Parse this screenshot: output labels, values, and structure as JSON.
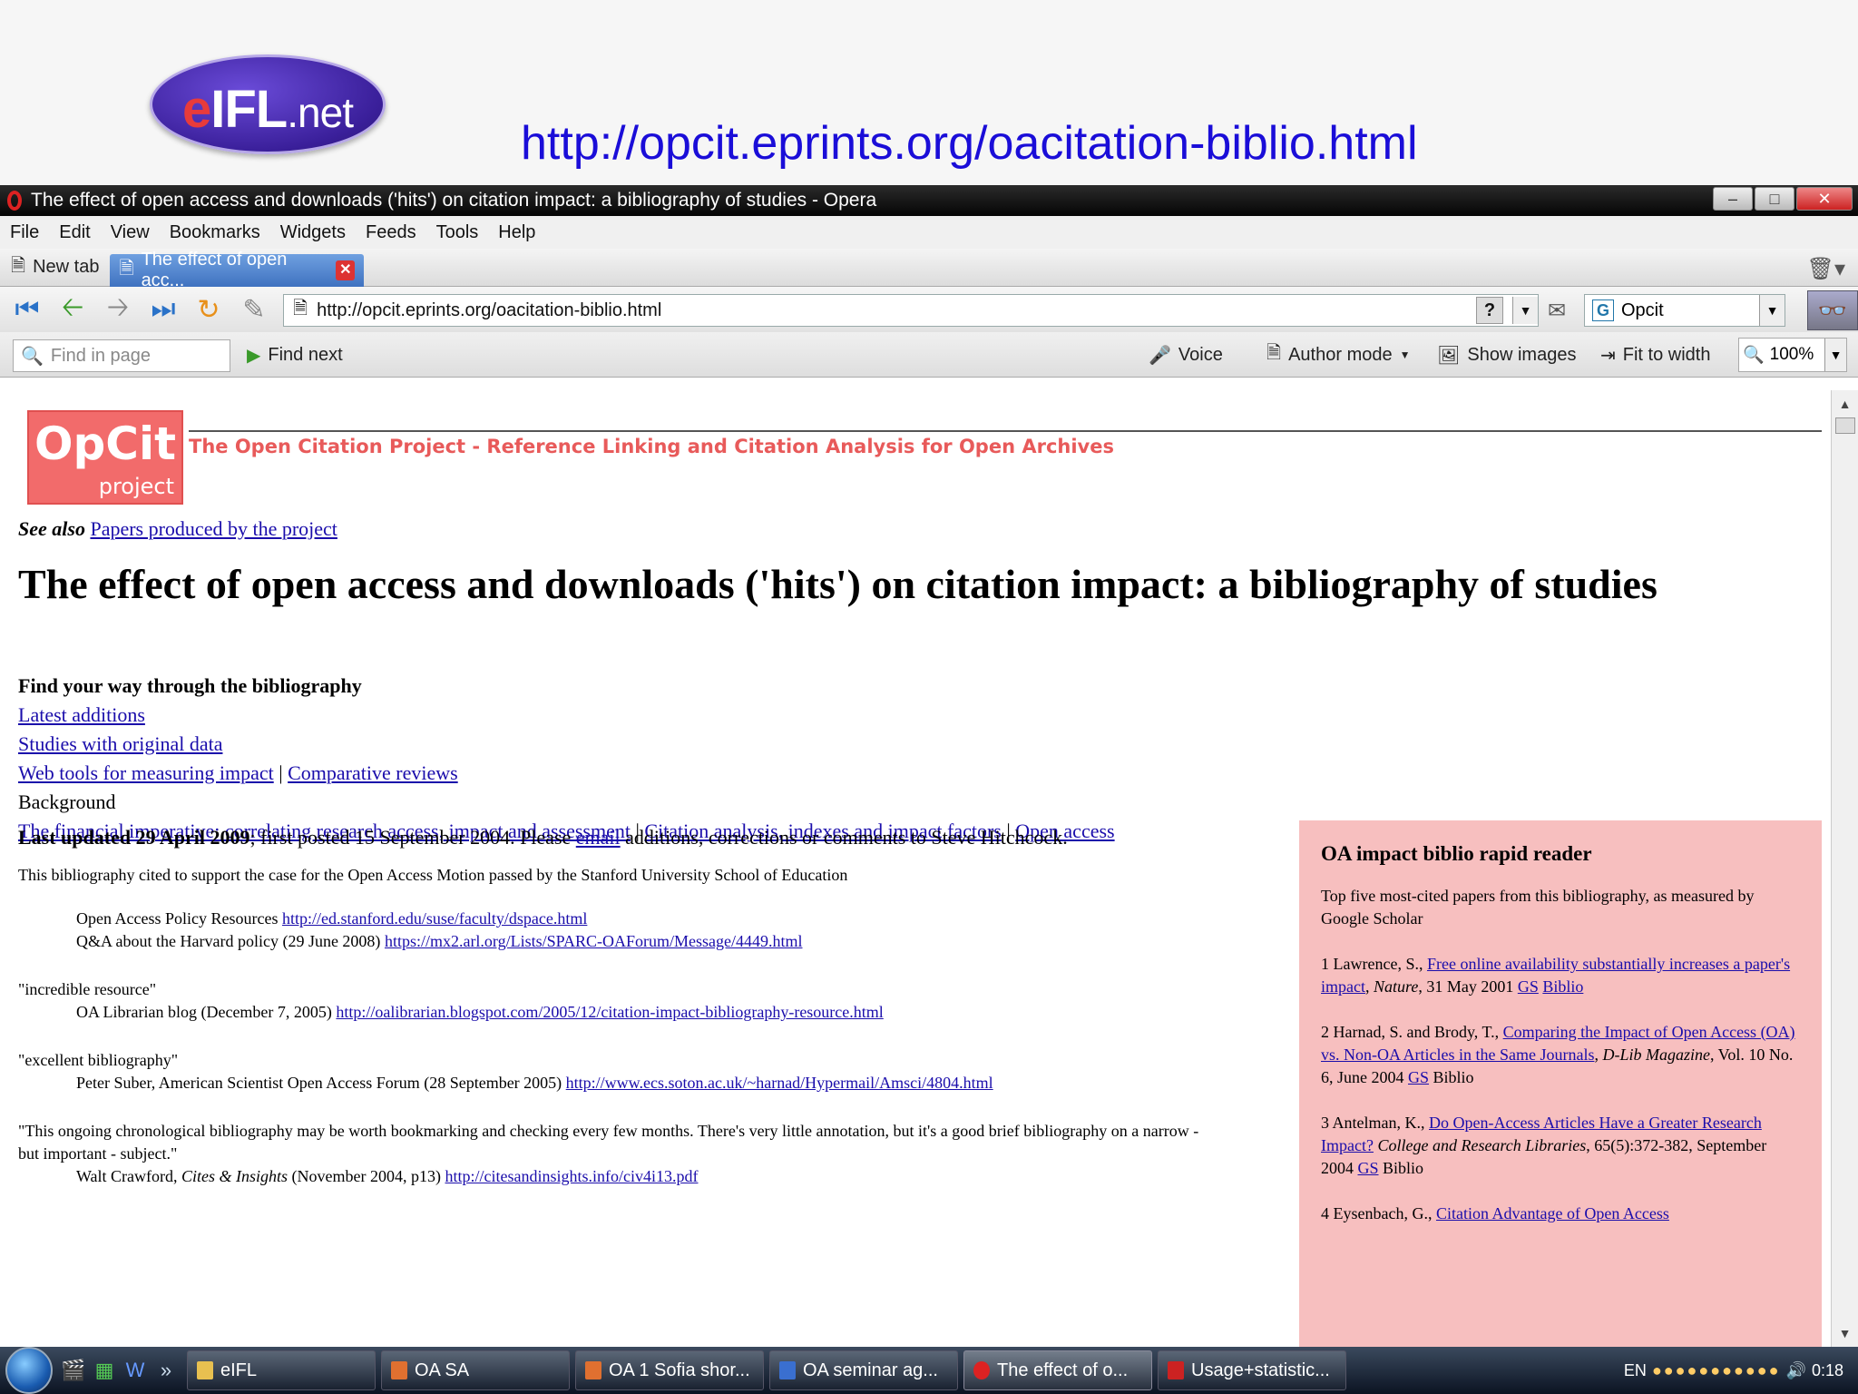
{
  "slide": {
    "logo_text": "eIFL.net",
    "logo_e": "e",
    "logo_ifl": "IFL",
    "logo_net": ".net",
    "url": "http://opcit.eprints.org/oacitation-biblio.html"
  },
  "window": {
    "title": "The effect of open access and downloads ('hits') on citation impact: a bibliography of studies - Opera",
    "menu": [
      "File",
      "Edit",
      "View",
      "Bookmarks",
      "Widgets",
      "Feeds",
      "Tools",
      "Help"
    ],
    "tabs": {
      "new_tab": "New tab",
      "active": "The effect of open acc..."
    },
    "address": "http://opcit.eprints.org/oacitation-biblio.html",
    "search_engine_value": "Opcit",
    "find_placeholder": "Find in page",
    "find_next": "Find next",
    "voice": "Voice",
    "author_mode": "Author mode",
    "show_images": "Show images",
    "fit_to_width": "Fit to width",
    "zoom": "100%"
  },
  "page": {
    "logo_big": "OpCit",
    "logo_small": "project",
    "tagline": "The Open Citation Project - Reference Linking and Citation Analysis for Open Archives",
    "see_also_label": "See also",
    "see_also_link": "Papers produced by the project",
    "heading": "The effect of open access and downloads ('hits') on citation impact: a bibliography of studies",
    "findway_heading": "Find your way through the bibliography",
    "nav_links": {
      "latest": "Latest additions",
      "original": "Studies with original data",
      "webtools": "Web tools for measuring impact",
      "reviews": "Comparative reviews",
      "background": "Background",
      "financial": "The financial imperative: correlating research access, impact and assessment",
      "citation": "Citation analysis, indexes and impact factors",
      "openaccess": "Open access"
    },
    "last_updated_bold": "Last updated 29 April 2009",
    "last_updated_rest": "; first posted 15 September 2004. Please ",
    "email_link": "email",
    "last_updated_tail": " additions, corrections or comments to Steve Hitchcock.",
    "stanford": "This bibliography cited to support the case for the Open Access Motion passed by the Stanford University School of Education",
    "oapr_label": "Open Access Policy Resources ",
    "oapr_link": "http://ed.stanford.edu/suse/faculty/dspace.html",
    "qa_label": "Q&A about the Harvard policy (29 June 2008) ",
    "qa_link": "https://mx2.arl.org/Lists/SPARC-OAForum/Message/4449.html",
    "q1": "\"incredible resource\"",
    "q1_src": "OA Librarian blog (December 7, 2005) ",
    "q1_link": "http://oalibrarian.blogspot.com/2005/12/citation-impact-bibliography-resource.html",
    "q2": "\"excellent bibliography\"",
    "q2_src": "Peter Suber, American Scientist Open Access Forum (28 September 2005) ",
    "q2_link": "http://www.ecs.soton.ac.uk/~harnad/Hypermail/Amsci/4804.html",
    "q3": "\"This ongoing chronological bibliography may be worth bookmarking and checking every few months. There's very little annotation, but it's a good brief bibliography on a narrow - but important - subject.\"",
    "q3_src_a": "Walt Crawford, ",
    "q3_src_em": "Cites & Insights",
    "q3_src_b": " (November 2004, p13) ",
    "q3_link": "http://citesandinsights.info/civ4i13.pdf"
  },
  "sidebar": {
    "heading": "OA impact biblio rapid reader",
    "intro": "Top five most-cited papers from this bibliography, as measured by Google Scholar",
    "items": [
      {
        "pre": "1 Lawrence, S., ",
        "link": "Free online availability substantially increases a paper's impact",
        "em": "Nature",
        "post": ", 31 May 2001 ",
        "gs": "GS",
        "biblio": "Biblio",
        "biblio_link": true
      },
      {
        "pre": "2 Harnad, S. and Brody, T., ",
        "link": "Comparing the Impact of Open Access (OA) vs. Non-OA Articles in the Same Journals",
        "em": "D-Lib Magazine",
        "post": ", Vol. 10 No. 6, June 2004 ",
        "gs": "GS",
        "biblio": "Biblio",
        "biblio_link": false
      },
      {
        "pre": "3 Antelman, K., ",
        "link": "Do Open-Access Articles Have a Greater Research Impact?",
        "em": "College and Research Libraries",
        "post": ", 65(5):372-382, September 2004 ",
        "gs": "GS",
        "biblio": "Biblio",
        "biblio_link": false
      },
      {
        "pre": "4 Eysenbach, G., ",
        "link": "Citation Advantage of Open Access"
      }
    ]
  },
  "taskbar": {
    "items": [
      "eIFL",
      "OA SA",
      "OA 1 Sofia shor...",
      "OA seminar ag...",
      "The effect of o...",
      "Usage+statistic..."
    ],
    "lang": "EN",
    "clock": "0:18"
  }
}
